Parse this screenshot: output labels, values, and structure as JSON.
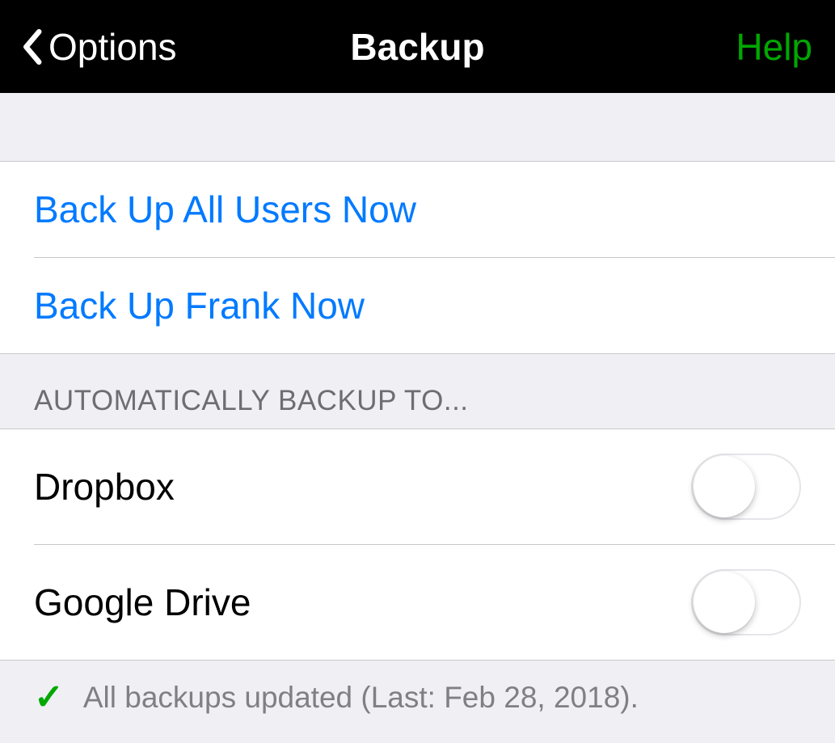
{
  "navbar": {
    "back_label": "Options",
    "title": "Backup",
    "help_label": "Help"
  },
  "actions": {
    "backup_all": "Back Up All Users Now",
    "backup_user": "Back Up Frank Now"
  },
  "auto_section": {
    "header": "AUTOMATICALLY BACKUP TO...",
    "items": [
      {
        "label": "Dropbox",
        "enabled": false
      },
      {
        "label": "Google Drive",
        "enabled": false
      }
    ]
  },
  "footer": {
    "status": "All backups updated (Last: Feb 28, 2018)."
  }
}
